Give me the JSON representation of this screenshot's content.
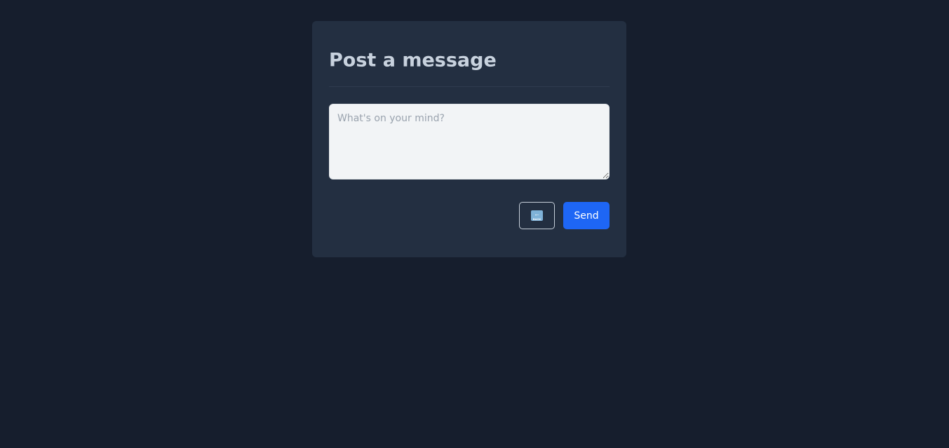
{
  "post_form": {
    "title": "Post a message",
    "message_input": {
      "placeholder": "What's on your mind?",
      "value": ""
    },
    "back_button": {
      "icon": "back-arrow-icon",
      "icon_arrow": "←",
      "icon_text": "BACK"
    },
    "send_label": "Send"
  },
  "colors": {
    "page_background": "#161e2d",
    "card_background": "#232f41",
    "title_text": "#c8d2de",
    "input_background": "#f2f4f6",
    "send_button": "#1e66f5",
    "back_icon": "#7fb2d8"
  }
}
